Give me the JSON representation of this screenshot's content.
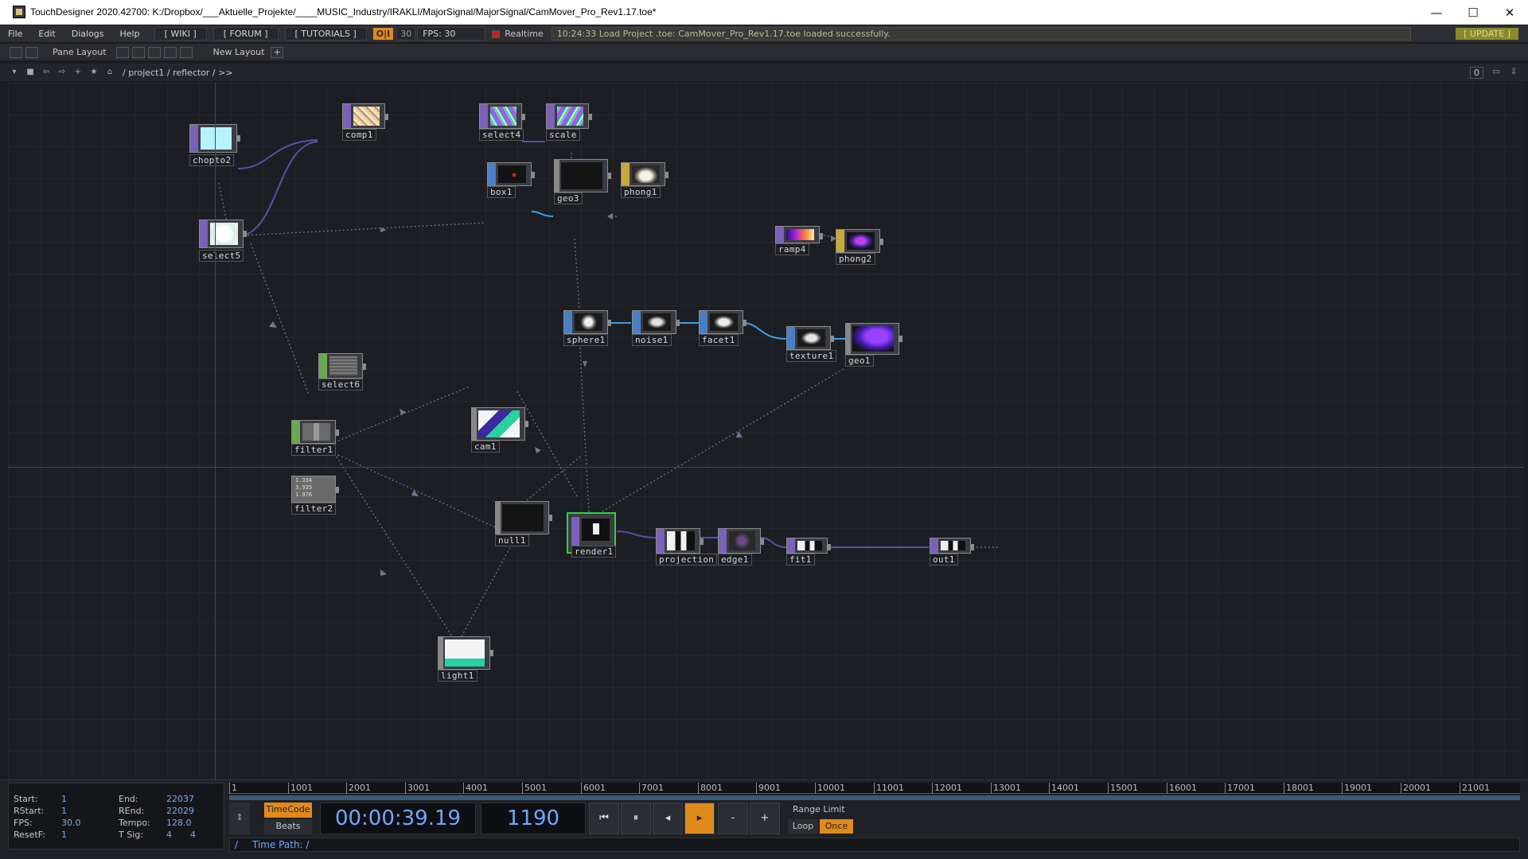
{
  "window": {
    "title": "TouchDesigner 2020.42700: K:/Dropbox/___Aktuelle_Projekte/____MUSIC_Industry/IRAKLI/MajorSignal/MajorSignal/CamMover_Pro_Rev1.17.toe*",
    "minimize": "—",
    "maximize": "☐",
    "close": "✕"
  },
  "menubar": {
    "file": "File",
    "edit": "Edit",
    "dialogs": "Dialogs",
    "help": "Help",
    "wiki": "[ WIKI ]",
    "forum": "[ FORUM ]",
    "tutorials": "[ TUTORIALS ]",
    "oi": "O|I",
    "fps_target": "30",
    "fps_label": "FPS: 30",
    "realtime": "Realtime",
    "status": "10:24:33 Load Project .toe: CamMover_Pro_Rev1.17.toe loaded successfully.",
    "update": "[ UPDATE ]"
  },
  "panebar": {
    "pane_layout": "Pane Layout",
    "new_layout": "New Layout",
    "add": "+"
  },
  "pathbar": {
    "path": "/ project1 / reflector / >>",
    "counter": "0"
  },
  "nodes": {
    "chopto2": "chopto2",
    "comp1": "comp1",
    "select4": "select4",
    "scale": "scale",
    "box1": "box1",
    "geo3": "geo3",
    "phong1": "phong1",
    "select5": "select5",
    "ramp4": "ramp4",
    "phong2": "phong2",
    "sphere1": "sphere1",
    "noise1": "noise1",
    "facet1": "facet1",
    "texture1": "texture1",
    "geo1": "geo1",
    "select6": "select6",
    "filter1": "filter1",
    "cam1": "cam1",
    "filter2": "filter2",
    "filter2_values": [
      "1.334",
      "3.935",
      "1.976"
    ],
    "render1": "render1",
    "projection": "projection",
    "edge1": "edge1",
    "fit1": "fit1",
    "out1": "out1",
    "null1": "null1",
    "light1": "light1"
  },
  "timeline_info": {
    "start_k": "Start:",
    "start_v": "1",
    "end_k": "End:",
    "end_v": "22037",
    "rstart_k": "RStart:",
    "rstart_v": "1",
    "rend_k": "REnd:",
    "rend_v": "22029",
    "fps_k": "FPS:",
    "fps_v": "30.0",
    "tempo_k": "Tempo:",
    "tempo_v": "128.0",
    "resetf_k": "ResetF:",
    "resetf_v": "1",
    "tsig_k": "T Sig:",
    "tsig_v1": "4",
    "tsig_v2": "4"
  },
  "ruler": [
    "1",
    "1001",
    "2001",
    "3001",
    "4001",
    "5001",
    "6001",
    "7001",
    "8001",
    "9001",
    "10001",
    "11001",
    "12001",
    "13001",
    "14001",
    "15001",
    "16001",
    "17001",
    "18001",
    "19001",
    "20001",
    "21001"
  ],
  "controls": {
    "timecode": "TimeCode",
    "beats": "Beats",
    "time": "00:00:39.19",
    "frame": "1190",
    "to_start": "⏮",
    "pause": "⏸",
    "step_back": "◂",
    "play": "▸",
    "minus": "-",
    "plus": "+",
    "range_limit": "Range Limit",
    "loop": "Loop",
    "once": "Once"
  },
  "timepath": {
    "slash": "/",
    "text": "Time Path: /"
  },
  "colors": {
    "top": "#7a62b8",
    "sop": "#4a7fc4",
    "mat": "#c8a83c",
    "dat": "#6aa84f",
    "accent_orange": "#e08a1c",
    "wire": "#5a4fa8"
  }
}
